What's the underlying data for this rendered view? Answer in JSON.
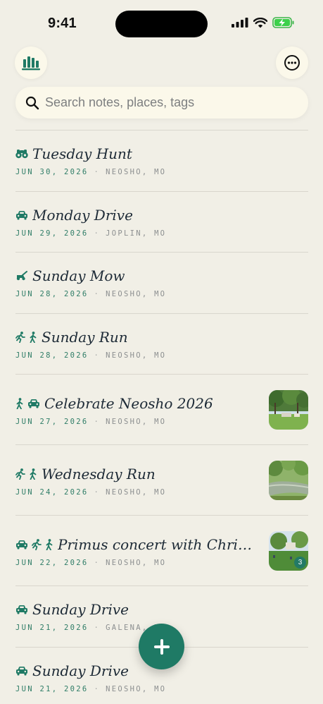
{
  "status": {
    "time": "9:41"
  },
  "search": {
    "placeholder": "Search notes, places, tags"
  },
  "header": {
    "left_icon": "stats-chart-icon",
    "right_icon": "more-options-icon"
  },
  "colors": {
    "accent": "#1f7a65",
    "background": "#f1efe6",
    "date": "#2f7d67"
  },
  "entries": [
    {
      "title": "Tuesday Hunt",
      "date": "JUN 30, 2026",
      "place": "NEOSHO, MO",
      "icons": [
        "binoculars-icon"
      ],
      "photo": null
    },
    {
      "title": "Monday Drive",
      "date": "JUN 29, 2026",
      "place": "JOPLIN, MO",
      "icons": [
        "car-icon"
      ],
      "photo": null
    },
    {
      "title": "Sunday Mow",
      "date": "JUN 28, 2026",
      "place": "NEOSHO, MO",
      "icons": [
        "mower-icon"
      ],
      "photo": null
    },
    {
      "title": "Sunday Run",
      "date": "JUN 28, 2026",
      "place": "NEOSHO, MO",
      "icons": [
        "run-icon",
        "walk-icon"
      ],
      "photo": null
    },
    {
      "title": "Celebrate Neosho 2026",
      "date": "JUN 27, 2026",
      "place": "NEOSHO, MO",
      "icons": [
        "walk-icon",
        "car-icon"
      ],
      "photo": "park"
    },
    {
      "title": "Wednesday Run",
      "date": "JUN 24, 2026",
      "place": "NEOSHO, MO",
      "icons": [
        "run-icon",
        "walk-icon"
      ],
      "photo": "creek"
    },
    {
      "title": "Primus concert with Chris W…",
      "date": "JUN 22, 2026",
      "place": "NEOSHO, MO",
      "icons": [
        "car-icon",
        "run-icon",
        "walk-icon"
      ],
      "photo": "lawn",
      "photo_count": "3"
    },
    {
      "title": "Sunday Drive",
      "date": "JUN 21, 2026",
      "place": "GALENA, KS",
      "icons": [
        "car-icon"
      ],
      "photo": null
    },
    {
      "title": "Sunday Drive",
      "date": "JUN 21, 2026",
      "place": "NEOSHO, MO",
      "icons": [
        "car-icon"
      ],
      "photo": null
    }
  ],
  "fab": {
    "icon": "plus-icon"
  }
}
